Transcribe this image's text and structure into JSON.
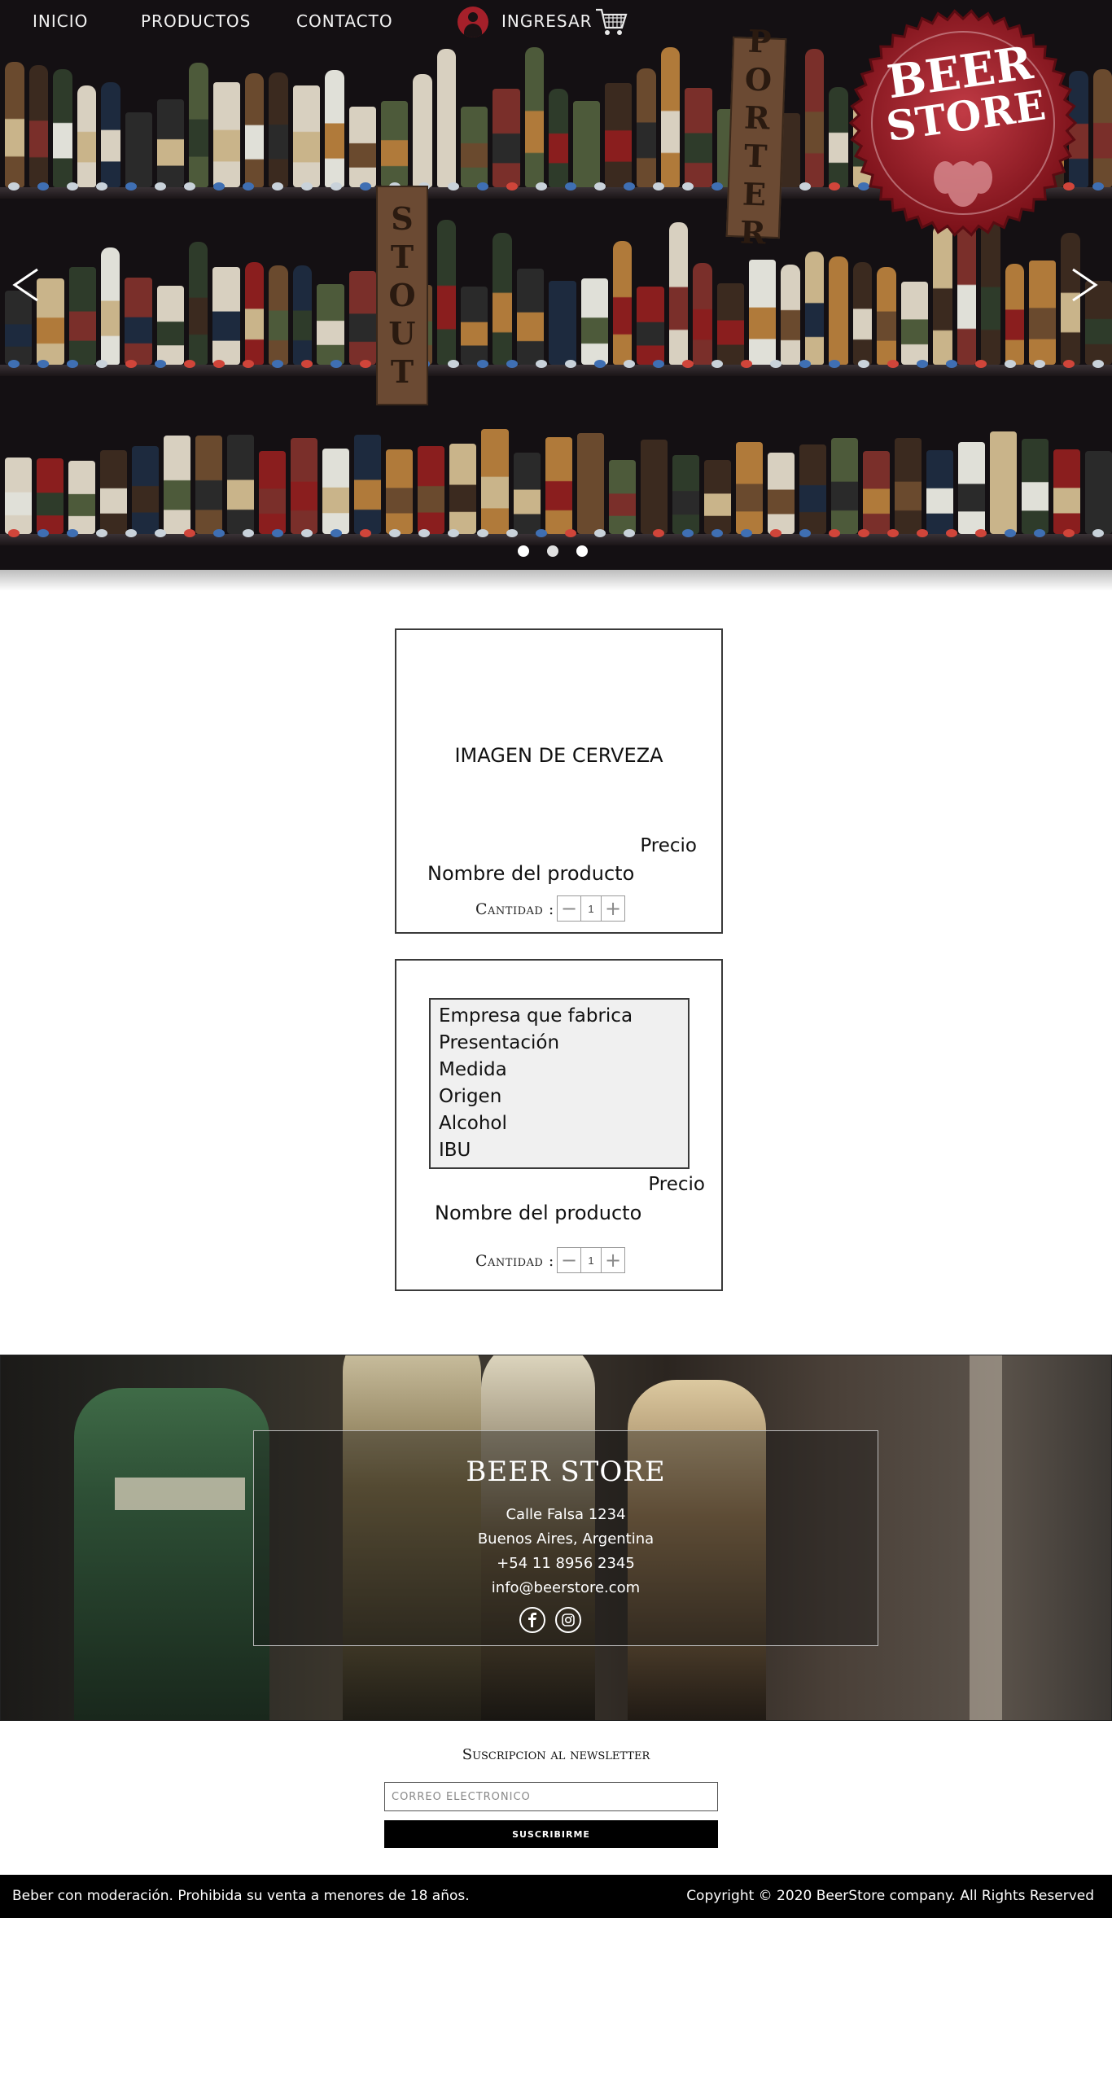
{
  "nav": {
    "inicio": "INICIO",
    "productos": "PRODUCTOS",
    "contacto": "CONTACTO",
    "ingresar": "INGRESAR",
    "user_icon": "user-icon",
    "cart_icon": "shopping-cart-icon"
  },
  "hero": {
    "logo_line1": "BEER",
    "logo_line2": "STORE",
    "sign_left": "STOUT",
    "sign_right": "PORTER",
    "prev_icon": "chevron-left-icon",
    "next_icon": "chevron-right-icon",
    "slides_count": 3,
    "active_slide": 2
  },
  "card1": {
    "image_placeholder": "IMAGEN DE CERVEZA",
    "price": "Precio",
    "product_name": "Nombre del producto",
    "qty_label": "Cantidad :",
    "qty_value": "1",
    "minus_icon": "minus-icon",
    "plus_icon": "plus-icon"
  },
  "card2": {
    "details": [
      "Empresa que fabrica",
      "Presentación",
      "Medida",
      "Origen",
      "Alcohol",
      "IBU"
    ],
    "price": "Precio",
    "product_name": "Nombre del producto",
    "qty_label": "Cantidad :",
    "qty_value": "1"
  },
  "footer": {
    "logo": "BEER STORE",
    "address": "Calle Falsa 1234",
    "city": "Buenos Aires, Argentina",
    "phone": "+54 11 8956 2345",
    "email": "info@beerstore.com",
    "facebook_icon": "facebook-icon",
    "instagram_icon": "instagram-icon"
  },
  "newsletter": {
    "title": "Suscripcion al newsletter",
    "placeholder": "Correo electronico",
    "button": "suscribirme"
  },
  "bottom_bar": {
    "disclaimer": "Beber con moderación. Prohibida su venta a menores de 18 años.",
    "copyright": "Copyright © 2020 BeerStore company. All Rights Reserved"
  },
  "colors": {
    "brand_red": "#a5202a",
    "black": "#000000",
    "card_border": "#3a3a3a"
  }
}
